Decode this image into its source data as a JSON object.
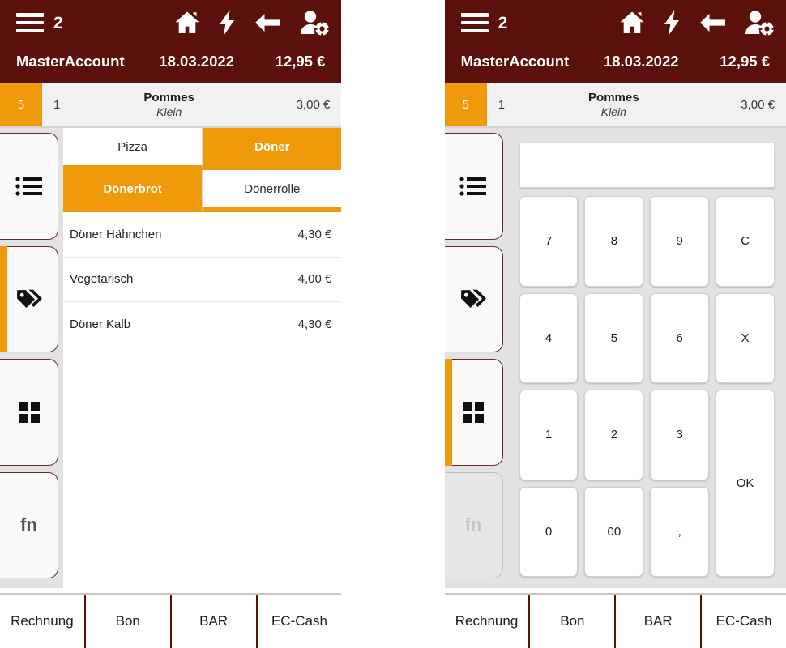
{
  "header": {
    "menu_icon": "hamburger-icon",
    "table_number": "2",
    "icons": [
      {
        "name": "home-icon"
      },
      {
        "name": "lightning-icon"
      },
      {
        "name": "back-arrow-icon"
      },
      {
        "name": "user-settings-icon"
      }
    ],
    "account": "MasterAccount",
    "date": "18.03.2022",
    "total": "12,95 €",
    "bg_color": "#5c100b"
  },
  "order_row": {
    "badge": "5",
    "quantity": "1",
    "name": "Pommes",
    "variant": "Klein",
    "price": "3,00 €",
    "badge_color": "#f0990a"
  },
  "rail": {
    "tabs": [
      {
        "name": "sidebar-tab-list",
        "icon": "list-icon",
        "label": "",
        "active": false,
        "disabled": false
      },
      {
        "name": "sidebar-tab-tags",
        "icon": "tag-icon",
        "label": "",
        "active": true,
        "disabled": false
      },
      {
        "name": "sidebar-tab-grid",
        "icon": "grid-icon",
        "label": "",
        "active": false,
        "disabled": false
      },
      {
        "name": "sidebar-tab-fn",
        "icon": "fn-icon",
        "label": "fn",
        "active": false,
        "disabled": false
      }
    ],
    "tabs_right": [
      {
        "name": "sidebar-tab-list",
        "icon": "list-icon",
        "label": "",
        "active": false,
        "disabled": false
      },
      {
        "name": "sidebar-tab-tags",
        "icon": "tag-icon",
        "label": "",
        "active": false,
        "disabled": false
      },
      {
        "name": "sidebar-tab-grid",
        "icon": "grid-icon",
        "label": "",
        "active": true,
        "disabled": false
      },
      {
        "name": "sidebar-tab-fn",
        "icon": "fn-icon",
        "label": "fn",
        "active": false,
        "disabled": true
      }
    ]
  },
  "category_tabs": {
    "row1": [
      {
        "label": "Pizza",
        "active": false
      },
      {
        "label": "Döner",
        "active": true
      }
    ],
    "row2": [
      {
        "label": "Dönerbrot",
        "active": true
      },
      {
        "label": "Dönerrolle",
        "active": false
      }
    ],
    "active_color": "#f0990a"
  },
  "products": [
    {
      "name": "Döner Hähnchen",
      "price": "4,30 €"
    },
    {
      "name": "Vegetarisch",
      "price": "4,00 €"
    },
    {
      "name": "Döner Kalb",
      "price": "4,30 €"
    }
  ],
  "keypad": {
    "display_value": "",
    "keys": [
      {
        "label": "7",
        "name": "key-7",
        "tall": false
      },
      {
        "label": "8",
        "name": "key-8",
        "tall": false
      },
      {
        "label": "9",
        "name": "key-9",
        "tall": false
      },
      {
        "label": "C",
        "name": "key-clear",
        "tall": false
      },
      {
        "label": "4",
        "name": "key-4",
        "tall": false
      },
      {
        "label": "5",
        "name": "key-5",
        "tall": false
      },
      {
        "label": "6",
        "name": "key-6",
        "tall": false
      },
      {
        "label": "X",
        "name": "key-multiply",
        "tall": false
      },
      {
        "label": "1",
        "name": "key-1",
        "tall": false
      },
      {
        "label": "2",
        "name": "key-2",
        "tall": false
      },
      {
        "label": "3",
        "name": "key-3",
        "tall": false
      },
      {
        "label": "OK",
        "name": "key-ok",
        "tall": true
      },
      {
        "label": "0",
        "name": "key-0",
        "tall": false
      },
      {
        "label": "00",
        "name": "key-double-zero",
        "tall": false
      },
      {
        "label": ",",
        "name": "key-comma",
        "tall": false
      }
    ]
  },
  "footer": {
    "buttons": [
      {
        "label": "Rechnung",
        "name": "footer-button-rechnung"
      },
      {
        "label": "Bon",
        "name": "footer-button-bon"
      },
      {
        "label": "BAR",
        "name": "footer-button-bar"
      },
      {
        "label": "EC-Cash",
        "name": "footer-button-ec-cash"
      }
    ]
  }
}
